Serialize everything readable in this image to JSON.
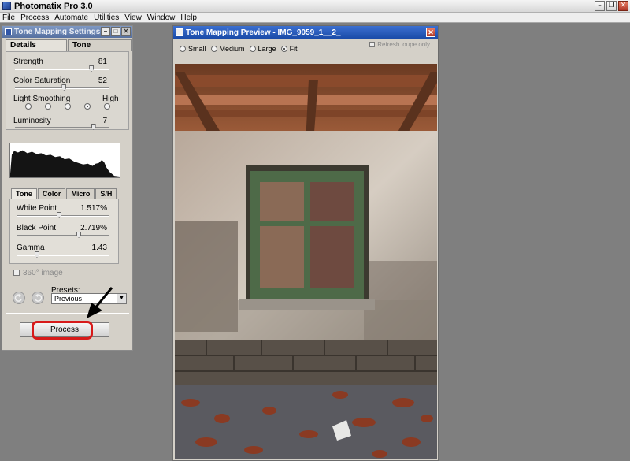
{
  "app": {
    "title": "Photomatix Pro 3.0",
    "menus": [
      "File",
      "Process",
      "Automate",
      "Utilities",
      "View",
      "Window",
      "Help"
    ]
  },
  "settings_palette": {
    "title": "Tone Mapping Settings",
    "tabs": [
      "Details Enhancer",
      "Tone Compressor"
    ],
    "sliders": [
      {
        "label": "Strength",
        "value": "81",
        "level": 0.81
      },
      {
        "label": "Color Saturation",
        "value": "52",
        "level": 0.52
      },
      {
        "label": "Luminosity",
        "value": "7",
        "level": 0.83
      }
    ],
    "light_smoothing": {
      "label": "Light Smoothing",
      "high_label": "High",
      "selected_index": 3,
      "option_count": 5
    },
    "sub_tabs": [
      "Tone",
      "Color",
      "Micro",
      "S/H"
    ],
    "tone_sliders": [
      {
        "label": "White Point",
        "value": "1.517%",
        "level": 0.46
      },
      {
        "label": "Black Point",
        "value": "2.719%",
        "level": 0.67
      },
      {
        "label": "Gamma",
        "value": "1.43",
        "level": 0.22
      }
    ],
    "checkbox_360": "360° image",
    "presets_label": "Presets:",
    "presets_value": "Previous",
    "process_button": "Process"
  },
  "preview_window": {
    "title": "Tone Mapping Preview - IMG_9059_1__2_",
    "zoom_options": [
      {
        "label": "Small",
        "selected": false
      },
      {
        "label": "Medium",
        "selected": false
      },
      {
        "label": "Large",
        "selected": false
      },
      {
        "label": "Fit",
        "selected": true
      }
    ],
    "refresh_loupe": "Refresh loupe only"
  },
  "colors": {
    "accent_red": "#d71a1a",
    "title_blue": "#1a4ba8"
  }
}
